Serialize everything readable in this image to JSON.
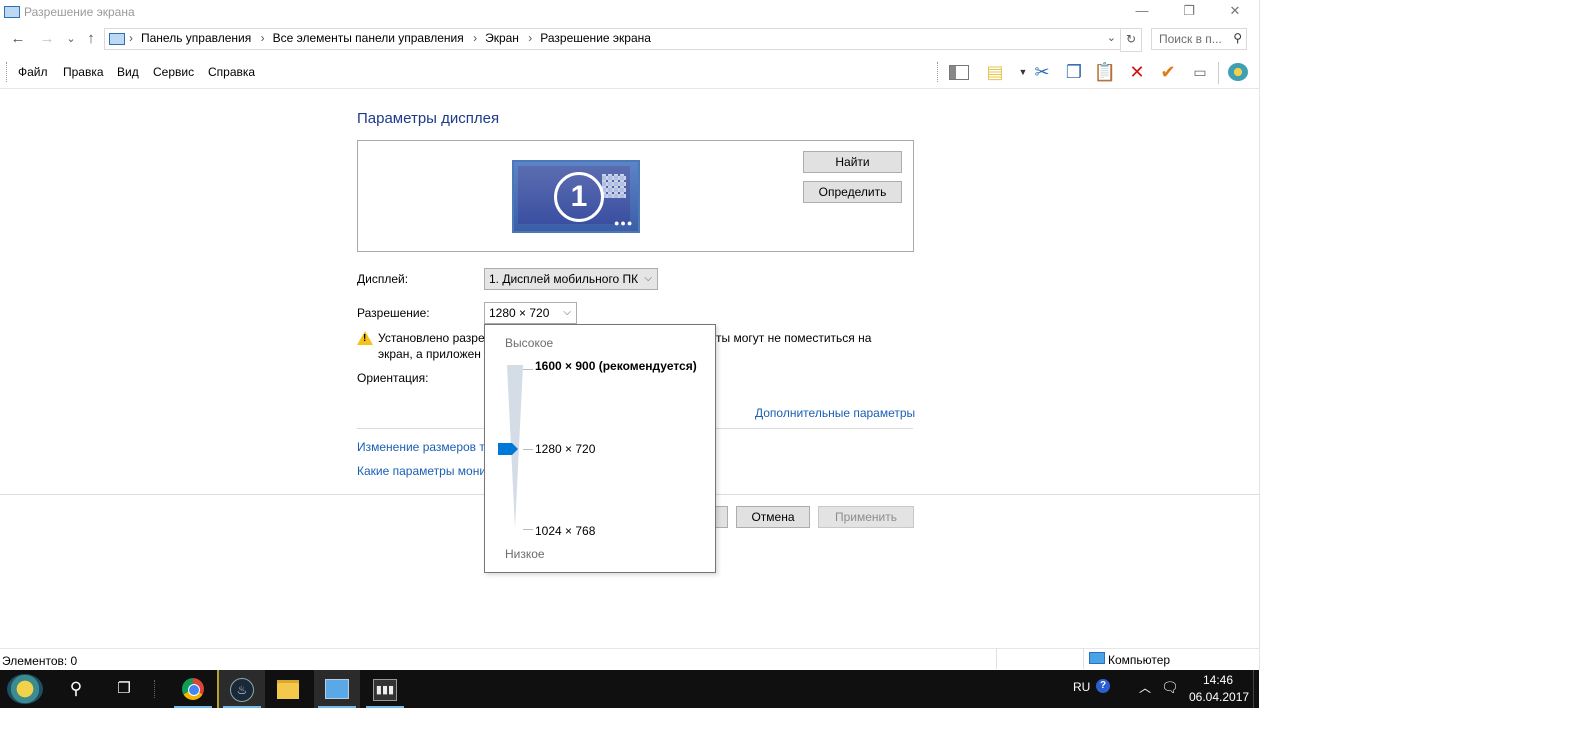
{
  "window": {
    "title": "Разрешение экрана",
    "minimize": "—",
    "restore": "❐",
    "close": "✕"
  },
  "nav": {
    "back": "←",
    "forward": "→",
    "recent": "⌄",
    "up": "↑",
    "breadcrumbs": [
      "Панель управления",
      "Все элементы панели управления",
      "Экран",
      "Разрешение экрана"
    ],
    "breadcrumb_sep": "›",
    "dropdown": "⌄",
    "refresh": "↻",
    "search_placeholder": "Поиск в п..."
  },
  "menu": {
    "items": [
      "Файл",
      "Правка",
      "Вид",
      "Сервис",
      "Справка"
    ]
  },
  "toolbar": {
    "icons": [
      "panel-layout-icon",
      "properties-icon",
      "cut-icon",
      "copy-icon",
      "paste-icon",
      "delete-icon",
      "check-icon",
      "rename-icon",
      "globe-icon"
    ]
  },
  "content": {
    "section_title": "Параметры дисплея",
    "monitor_number": "1",
    "find_button": "Найти",
    "identify_button": "Определить",
    "display_label": "Дисплей:",
    "display_value": "1. Дисплей мобильного ПК",
    "resolution_label": "Разрешение:",
    "resolution_value": "1280 × 720",
    "warning_line1_a": "Установлено разре",
    "warning_line1_b": "ты могут не поместиться на",
    "warning_line2": "экран, а приложен",
    "orientation_label": "Ориентация:",
    "advanced_link": "Дополнительные параметры",
    "link1": "Изменение размеров те",
    "link2": "Какие параметры мони",
    "cancel_button": "Отмена",
    "apply_button": "Применить"
  },
  "popup": {
    "high_label": "Высокое",
    "low_label": "Низкое",
    "options": [
      "1600 × 900 (рекомендуется)",
      "1280 × 720",
      "1024 × 768"
    ],
    "selected_index": 1
  },
  "statusbar": {
    "items_text": "Элементов: 0",
    "computer_text": "Компьютер"
  },
  "taskbar": {
    "apps": [
      "search-icon",
      "task-view-icon",
      "chrome-icon",
      "steam-icon",
      "file-explorer-icon",
      "control-panel-icon",
      "app-icon"
    ],
    "lang": "RU",
    "help": "?",
    "time": "14:46",
    "date": "06.04.2017"
  },
  "colors": {
    "link": "#1a5fb4",
    "title_blue": "#1e3a8a",
    "taskbar": "#101010",
    "accent": "#0078d7"
  }
}
